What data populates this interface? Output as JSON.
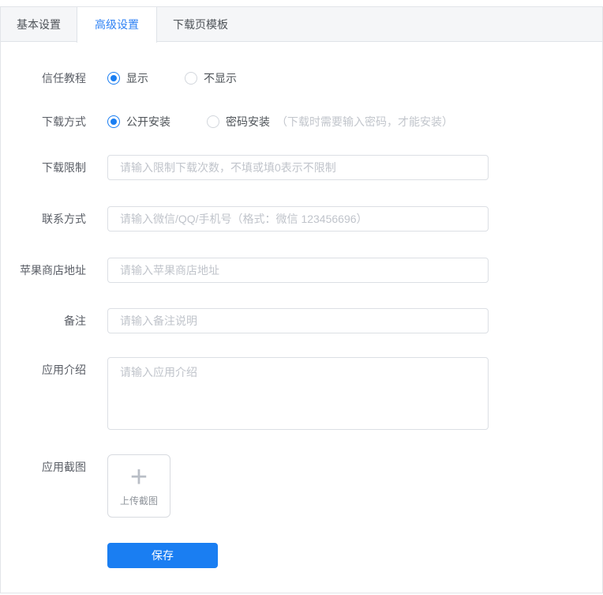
{
  "tabs": [
    {
      "label": "基本设置",
      "active": false
    },
    {
      "label": "高级设置",
      "active": true
    },
    {
      "label": "下载页模板",
      "active": false
    }
  ],
  "form": {
    "trust_tutorial": {
      "label": "信任教程",
      "options": [
        {
          "label": "显示",
          "selected": true
        },
        {
          "label": "不显示",
          "selected": false
        }
      ]
    },
    "download_method": {
      "label": "下载方式",
      "options": [
        {
          "label": "公开安装",
          "selected": true
        },
        {
          "label": "密码安装",
          "selected": false
        }
      ],
      "hint": "（下载时需要输入密码，才能安装）"
    },
    "download_limit": {
      "label": "下载限制",
      "value": "",
      "placeholder": "请输入限制下载次数，不填或填0表示不限制"
    },
    "contact": {
      "label": "联系方式",
      "value": "",
      "placeholder": "请输入微信/QQ/手机号（格式：微信 123456696）"
    },
    "apple_store": {
      "label": "苹果商店地址",
      "value": "",
      "placeholder": "请输入苹果商店地址"
    },
    "remark": {
      "label": "备注",
      "value": "",
      "placeholder": "请输入备注说明"
    },
    "app_intro": {
      "label": "应用介绍",
      "value": "",
      "placeholder": "请输入应用介绍"
    },
    "app_screenshot": {
      "label": "应用截图",
      "plus_icon": "+",
      "upload_text": "上传截图"
    },
    "save_label": "保存"
  },
  "colors": {
    "primary": "#1a7ef2",
    "tab_active_text": "#2f82f4",
    "tab_bar_bg": "#f5f6f8",
    "border": "#dcdfe4",
    "placeholder_text": "#c0c4cb",
    "label_text": "#5a5e66"
  }
}
